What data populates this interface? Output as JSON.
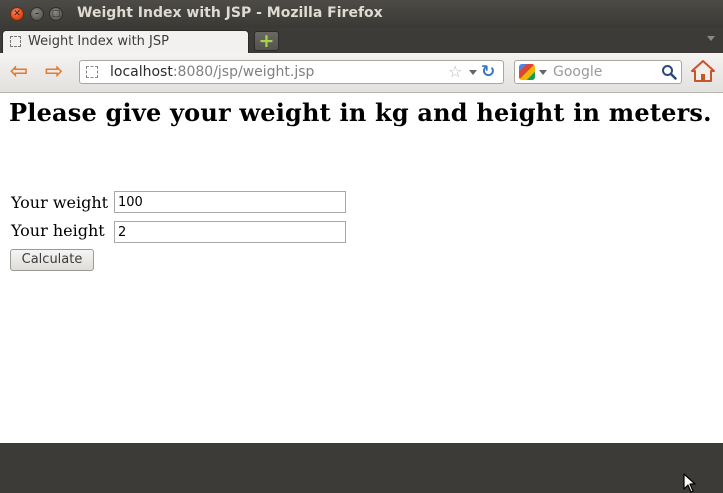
{
  "window": {
    "title": "Weight Index with JSP - Mozilla Firefox"
  },
  "tabs": [
    {
      "label": "Weight Index with JSP",
      "active": true
    }
  ],
  "toolbar": {
    "url_host": "localhost",
    "url_rest": ":8080/jsp/weight.jsp",
    "search_placeholder": "Google",
    "search_engine_icon": "google-icon"
  },
  "page": {
    "heading": "Please give your weight in kg and height in meters.",
    "weight_label": "Your weight",
    "weight_value": "100",
    "height_label": "Your height",
    "height_value": "2",
    "button_label": "Calculate"
  },
  "colors": {
    "titlebar": "#3c3b37",
    "accent_orange": "#e57a2c",
    "close_button": "#df4a16"
  }
}
